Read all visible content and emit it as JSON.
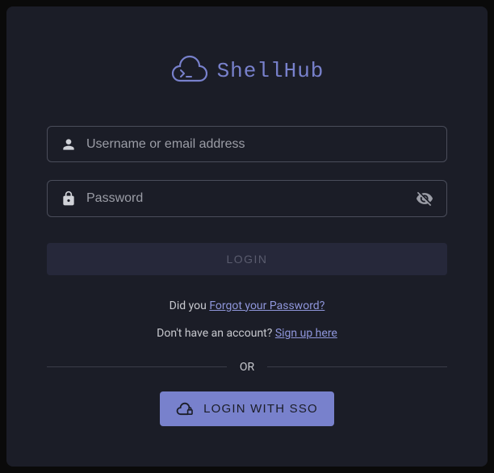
{
  "logo": {
    "brand_name": "ShellHub"
  },
  "form": {
    "username_placeholder": "Username or email address",
    "password_placeholder": "Password",
    "login_button": "LOGIN"
  },
  "helpers": {
    "forgot_prefix": "Did you ",
    "forgot_link": "Forgot your Password?",
    "signup_prefix": "Don't have an account? ",
    "signup_link": "Sign up here",
    "or_divider": "OR"
  },
  "sso": {
    "button_label": "LOGIN WITH SSO"
  }
}
